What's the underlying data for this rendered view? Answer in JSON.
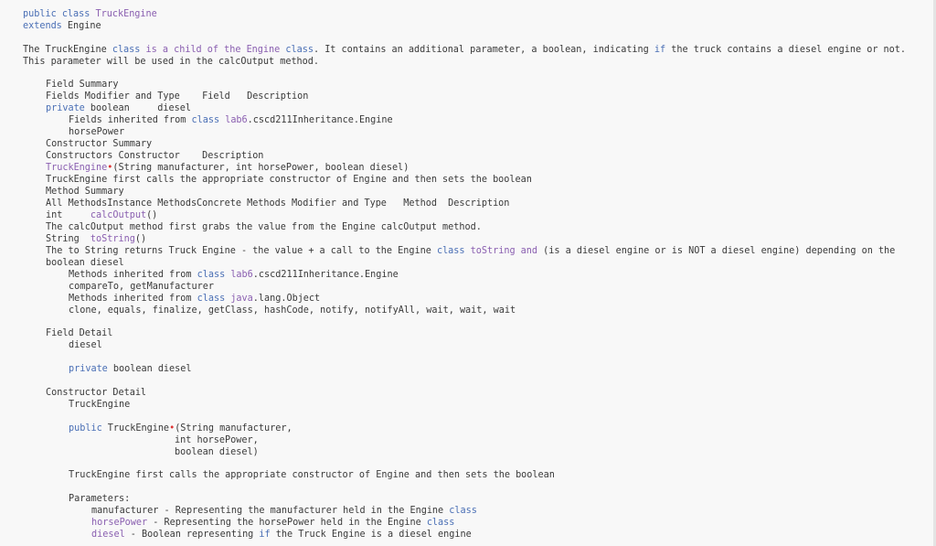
{
  "header": {
    "decl_public": "public",
    "decl_class": "class",
    "class_name": "TruckEngine",
    "extends_kw": "extends",
    "extends_name": "Engine"
  },
  "intro": {
    "p1_a": "The TruckEngine ",
    "p1_kw_class": "class",
    "p1_b": " ",
    "p1_cls_text": "is a child of the Engine",
    "p1_c": " ",
    "p1_kw_class2": "class",
    "p1_d": ". It contains an additional parameter, a boolean, indicating ",
    "p1_kw_if": "if",
    "p1_e": " the truck contains a diesel engine or not.",
    "p2": "This parameter will be used in the calcOutput method."
  },
  "field_summary": {
    "title": "Field Summary",
    "header_row": "Fields Modifier and Type    Field   Description",
    "row_modifier_kw": "private",
    "row_type": " boolean     ",
    "row_field": "diesel",
    "inherited_prefix": "Fields inherited from ",
    "inherited_kw": "class",
    "inherited_space": " ",
    "inherited_pkg": "lab6",
    "inherited_rest": ".cscd211Inheritance.Engine",
    "inherited_fields": "horsePower"
  },
  "constructor_summary": {
    "title": "Constructor Summary",
    "header_row": "Constructors Constructor    Description",
    "ctor_name": "TruckEngine",
    "ctor_params": "(String manufacturer, int horsePower, boolean diesel)",
    "ctor_desc": "TruckEngine first calls the appropriate constructor of Engine and then sets the boolean"
  },
  "method_summary": {
    "title": "Method Summary",
    "header_row": "All MethodsInstance MethodsConcrete Methods Modifier and Type   Method  Description",
    "methods": [
      {
        "type": "int     ",
        "name": "calcOutput",
        "parens": "()",
        "desc": "The calcOutput method first grabs the value from the Engine calcOutput method."
      },
      {
        "type": "String  ",
        "name": "toString",
        "parens": "()",
        "desc_a": "The to String returns Truck Engine - the value + a call to the Engine ",
        "desc_kw_class": "class",
        "desc_b": " ",
        "desc_cls": "toString and",
        "desc_c": " (is a diesel engine or is NOT a diesel engine) depending on the",
        "desc_line2": "boolean diesel"
      }
    ],
    "inherited_engine_prefix": "Methods inherited from ",
    "inherited_engine_kw": "class",
    "inherited_engine_space": " ",
    "inherited_engine_pkg": "lab6",
    "inherited_engine_rest": ".cscd211Inheritance.Engine",
    "inherited_engine_methods": "compareTo, getManufacturer",
    "inherited_object_prefix": "Methods inherited from ",
    "inherited_object_kw": "class",
    "inherited_object_space": " ",
    "inherited_object_pkg": "java",
    "inherited_object_rest": ".lang.Object",
    "inherited_object_methods": "clone, equals, finalize, getClass, hashCode, notify, notifyAll, wait, wait, wait"
  },
  "field_detail": {
    "title": "Field Detail",
    "name": "diesel",
    "sig_kw": "private",
    "sig_rest": " boolean diesel"
  },
  "constructor_detail": {
    "title": "Constructor Detail",
    "name": "TruckEngine",
    "sig_kw": "public",
    "sig_name": " TruckEngine",
    "sig_line1": "(String manufacturer,",
    "sig_line2": "int horsePower,",
    "sig_line3": "boolean diesel)",
    "desc": "TruckEngine first calls the appropriate constructor of Engine and then sets the boolean",
    "params_title": "Parameters:",
    "params": [
      {
        "name": "manufacturer",
        "desc_a": " - Representing the manufacturer held in the Engine ",
        "desc_kw": "class",
        "desc_b": ""
      },
      {
        "name": "horsePower",
        "desc_a": " - Representing the horsePower held in the Engine ",
        "desc_kw": "class",
        "desc_b": ""
      },
      {
        "name": "diesel",
        "desc_a": " - Boolean representing ",
        "desc_kw": "if",
        "desc_b": " the Truck Engine is a diesel engine"
      }
    ]
  },
  "colors": {
    "background": "#f8f8f8",
    "text": "#3a3a3a",
    "keyword": "#4a6fb5",
    "class_name": "#8a5fb0",
    "marker_dot": "#dd3333"
  }
}
